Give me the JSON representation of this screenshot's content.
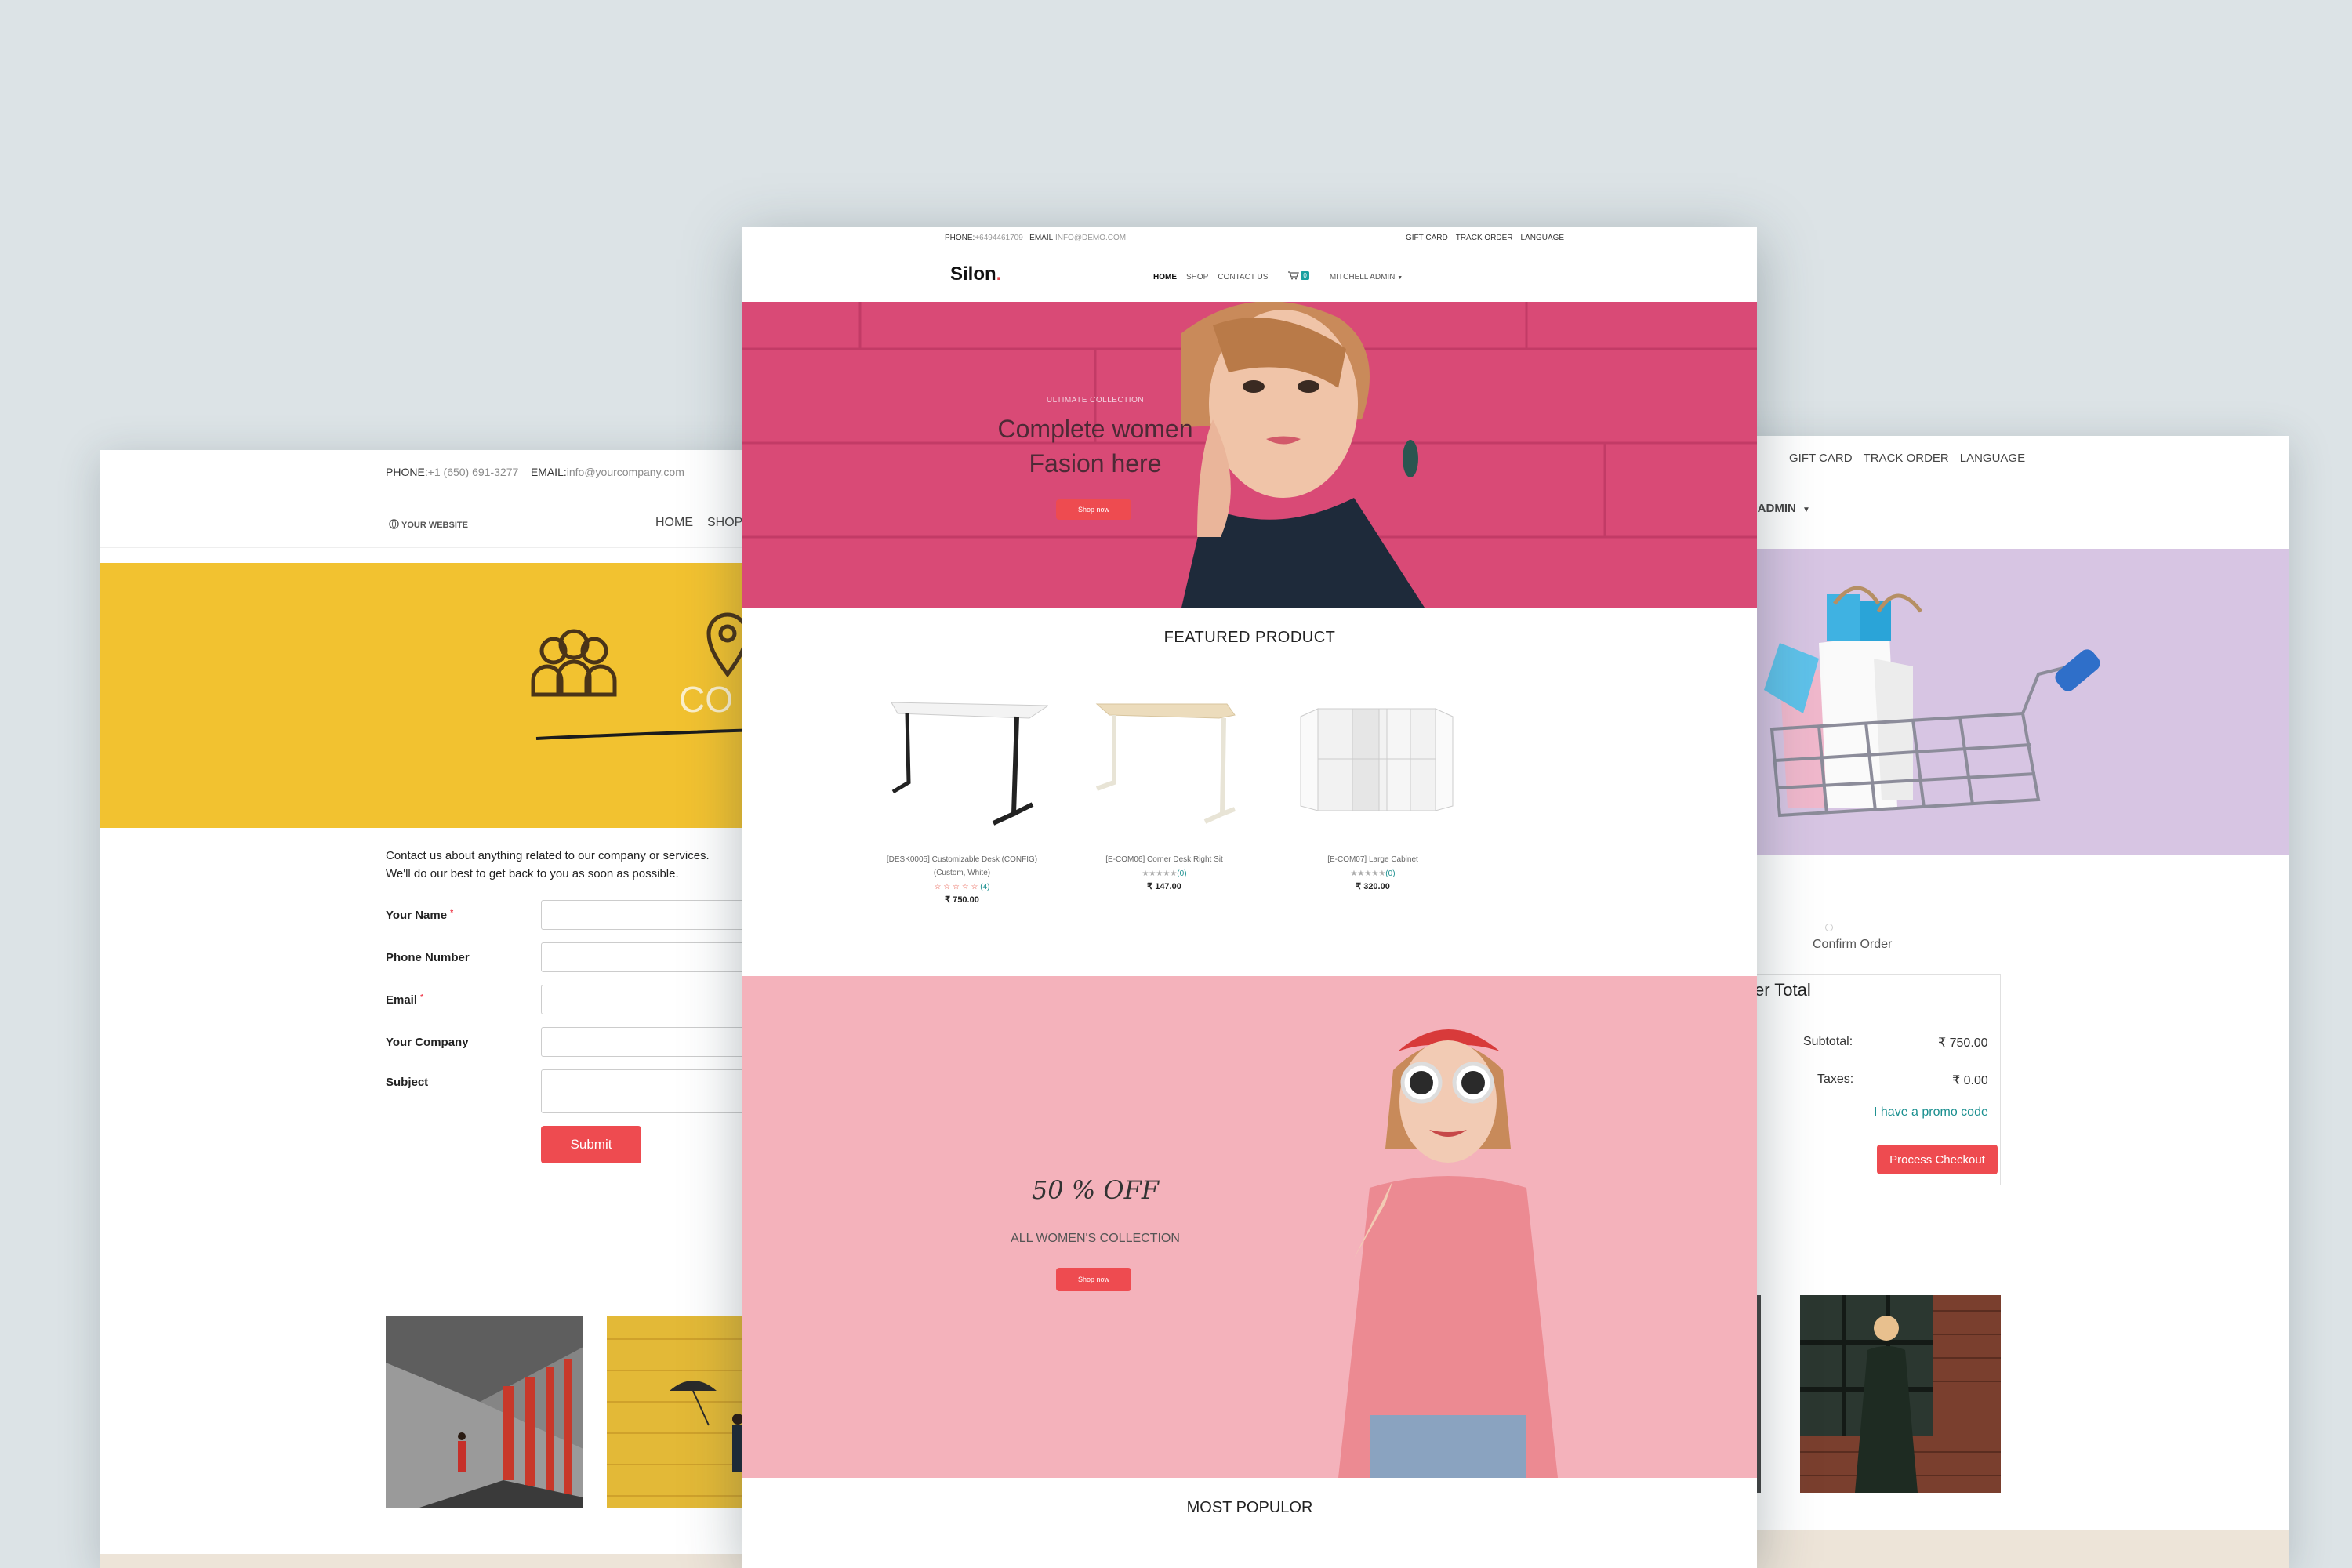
{
  "left_window": {
    "phone_label": "PHONE:",
    "phone_value": "+1 (650) 691-3277",
    "email_label": "EMAIL:",
    "email_value": "info@yourcompany.com",
    "logo": "YOUR WEBSITE",
    "nav": [
      "HOME",
      "SHOP"
    ],
    "hero_partial_text": "CO",
    "intro_line1": "Contact us about anything related to our company or services.",
    "intro_line2": "We'll do our best to get back to you as soon as possible.",
    "form_fields": [
      {
        "label": "Your Name",
        "required": "*"
      },
      {
        "label": "Phone Number",
        "required": ""
      },
      {
        "label": "Email",
        "required": "*"
      },
      {
        "label": "Your Company",
        "required": ""
      },
      {
        "label": "Subject",
        "required": ""
      }
    ],
    "submit_label": "Submit"
  },
  "center_window": {
    "phone_label": "PHONE:",
    "phone_value": "+6494461709",
    "email_label": "EMAIL:",
    "email_value": "INFO@DEMO.COM",
    "top_links": [
      "GIFT CARD",
      "TRACK ORDER",
      "LANGUAGE"
    ],
    "logo": "Silon",
    "logo_dot": ".",
    "nav": [
      "HOME",
      "SHOP",
      "CONTACT US"
    ],
    "cart_count": "0",
    "user_menu": "MITCHELL ADMIN",
    "hero": {
      "kicker": "ULTIMATE COLLECTION",
      "title_line1": "Complete women",
      "title_line2": "Fasion here",
      "button": "Shop now"
    },
    "featured_title": "FEATURED PRODUCT",
    "products": [
      {
        "name_line1": "[DESK0005] Customizable Desk (CONFIG)",
        "name_line2": "(Custom, White)",
        "stars": "☆ ☆ ☆ ☆ ☆",
        "reviews": "(4)",
        "price": "₹ 750.00"
      },
      {
        "name_line1": "[E-COM06] Corner Desk Right Sit",
        "name_line2": "",
        "stars": "★★★★★",
        "reviews": "(0)",
        "price": "₹ 147.00"
      },
      {
        "name_line1": "[E-COM07] Large Cabinet",
        "name_line2": "",
        "stars": "★★★★★",
        "reviews": "(0)",
        "price": "₹ 320.00"
      }
    ],
    "promo": {
      "discount": "50 % OFF",
      "subtitle": "ALL WOMEN'S COLLECTION",
      "button": "Shop now"
    },
    "most_popular_title": "MOST POPULOR"
  },
  "right_window": {
    "top_links": [
      "GIFT CARD",
      "TRACK ORDER",
      "LANGUAGE"
    ],
    "user_menu_partial": "LL ADMIN",
    "confirm_step": "Confirm Order",
    "order_title_partial": "er Total",
    "subtotal_label": "Subtotal:",
    "subtotal_value": "₹ 750.00",
    "taxes_label": "Taxes:",
    "taxes_value": "₹ 0.00",
    "promo_link": "I have a promo code",
    "checkout_button": "Process Checkout"
  },
  "colors": {
    "background": "#dce3e6",
    "accent_red": "#ee4b50",
    "teal": "#1a8f8f",
    "hero_pink": "#d94a76",
    "promo_pink": "#f4b2bb",
    "yellow": "#f2c230",
    "lavender": "#d6c3e2"
  }
}
